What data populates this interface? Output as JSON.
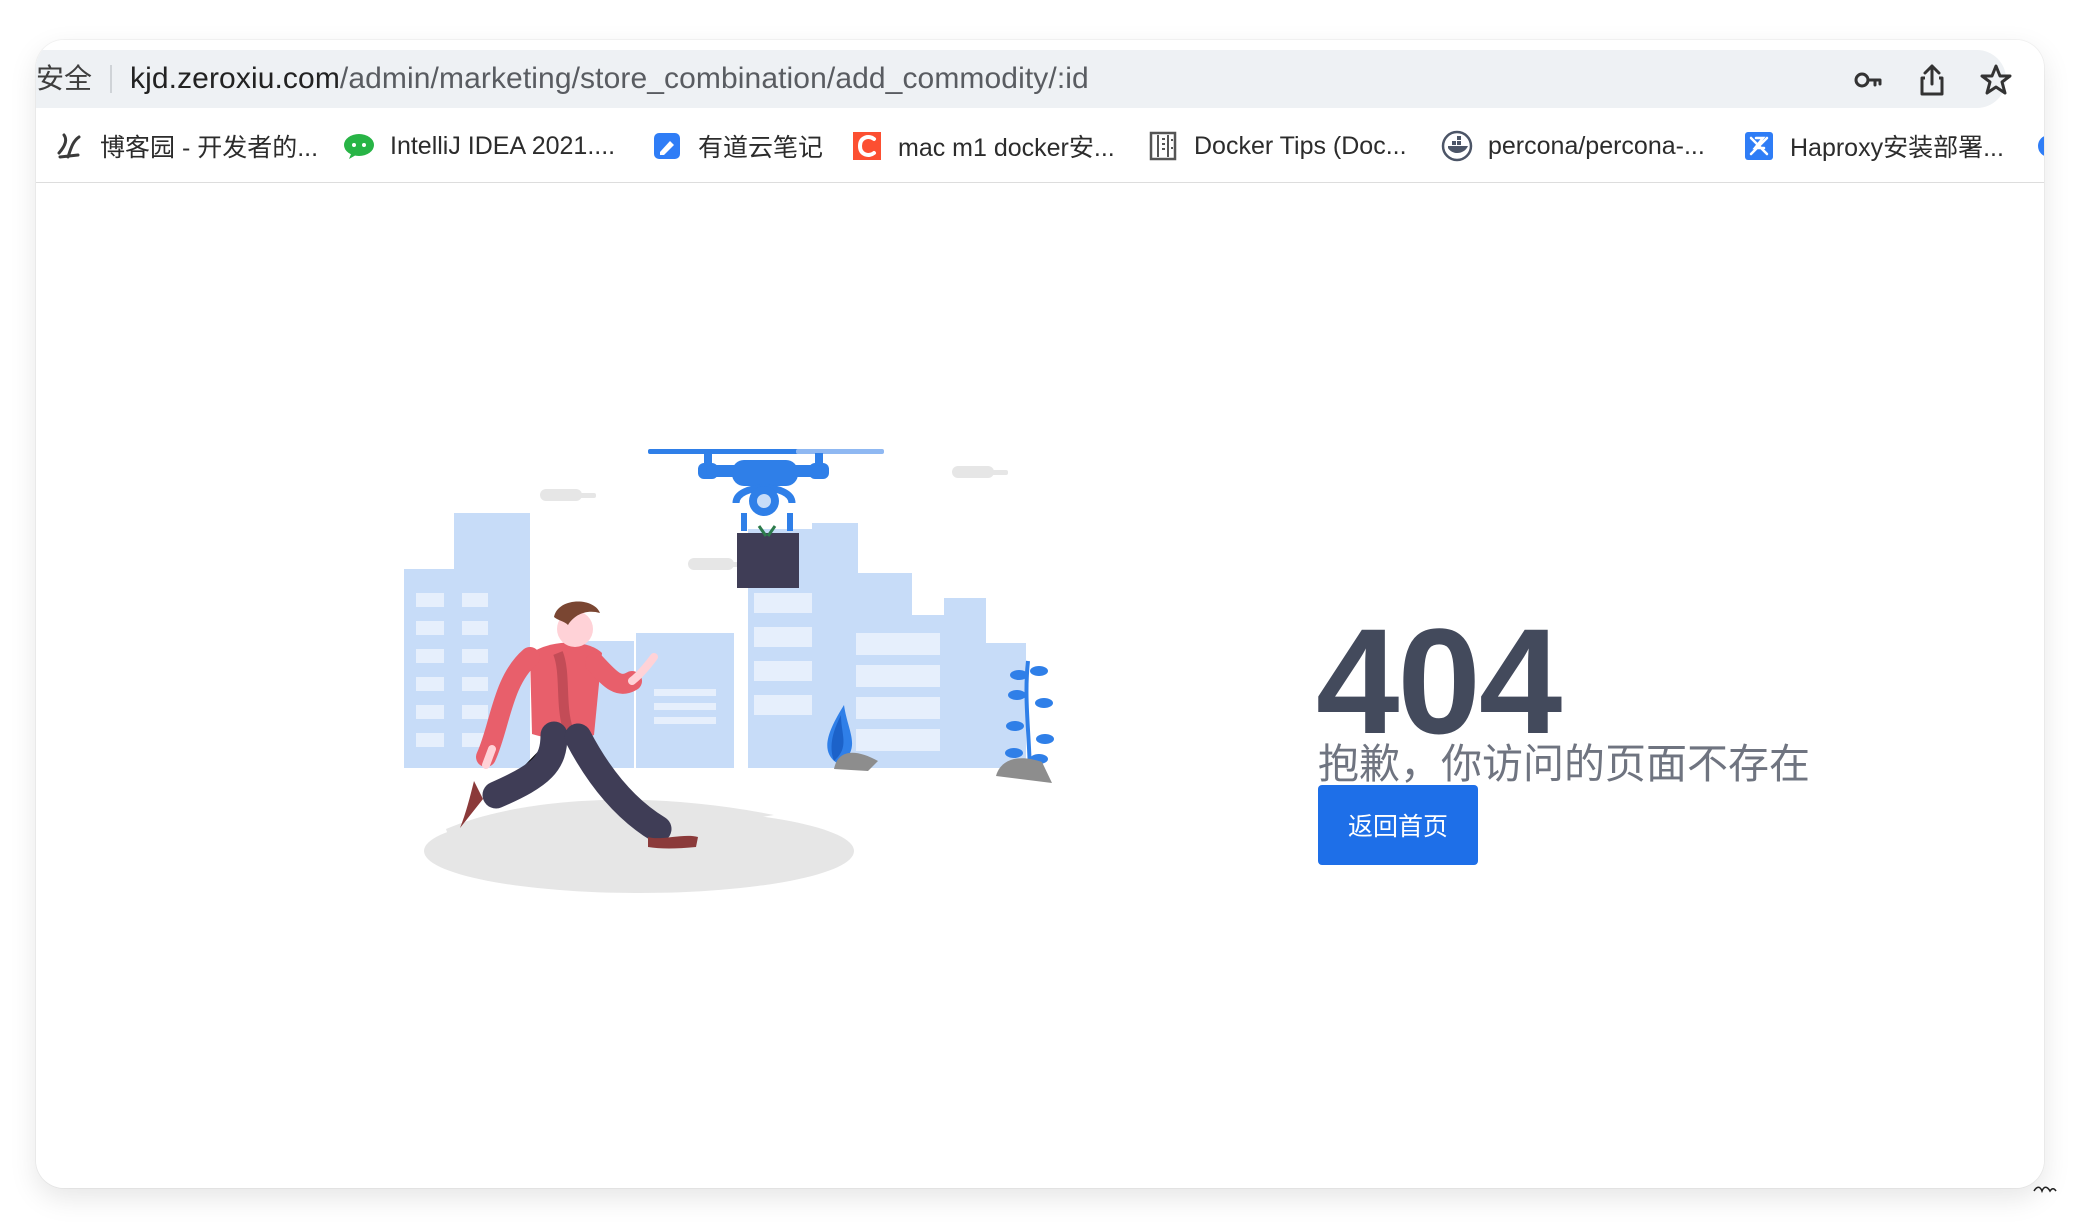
{
  "browser": {
    "security_label": "安全",
    "url_domain": "kjd.zeroxiu.com",
    "url_path": "/admin/marketing/store_combination/add_commodity/:id",
    "icons": {
      "password": "key-icon",
      "share": "share-icon",
      "bookmark": "star-icon"
    }
  },
  "bookmarks": [
    {
      "label": "博客园 - 开发者的...",
      "icon": "cnblogs-icon",
      "color": "#3b3b3b"
    },
    {
      "label": "IntelliJ IDEA 2021....",
      "icon": "wechat-icon",
      "color": "#28b446"
    },
    {
      "label": "有道云笔记",
      "icon": "youdao-note-icon",
      "color": "#2f7df6"
    },
    {
      "label": "mac m1 docker安...",
      "icon": "csdn-icon",
      "color": "#fc4f31"
    },
    {
      "label": "Docker Tips (Doc...",
      "icon": "docker-tips-icon",
      "color": "#555555"
    },
    {
      "label": "percona/percona-...",
      "icon": "docker-hub-icon",
      "color": "#4c5567"
    },
    {
      "label": "Haproxy安装部署...",
      "icon": "haproxy-icon",
      "color": "#2f7df6"
    }
  ],
  "page": {
    "error_code": "404",
    "message": "抱歉，你访问的页面不存在",
    "home_button": "返回首页",
    "colors": {
      "primary": "#1e6fe8",
      "heading": "#434a5c",
      "muted": "#6f7480",
      "city": "#c7dcf8",
      "drone": "#2f7fe8",
      "runner_shirt": "#e85f6b"
    }
  }
}
